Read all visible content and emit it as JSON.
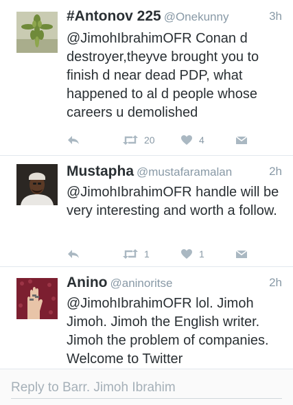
{
  "tweets": [
    {
      "name": "#Antonov 225",
      "handle": "@Onekunny",
      "time": "3h",
      "text": "@JimohIbrahimOFR Conan d destroyer,theyve brought you to finish d near dead PDP, what happened to al d people whose careers u demolished",
      "retweets": "20",
      "likes": "4",
      "avatar_icon": "leaf-cross-icon"
    },
    {
      "name": "Mustapha",
      "handle": "@mustafaramalan",
      "time": "2h",
      "text": "@JimohIbrahimOFR handle will be very interesting and worth a follow.",
      "retweets": "1",
      "likes": "1",
      "avatar_icon": "person-photo-icon"
    },
    {
      "name": "Anino",
      "handle": "@aninoritse",
      "time": "2h",
      "text": "@JimohIbrahimOFR lol. Jimoh Jimoh. Jimoh the English writer. Jimoh the problem of companies. Welcome to Twitter",
      "retweets": "",
      "likes": "",
      "avatar_icon": "hand-rings-icon"
    }
  ],
  "reply": {
    "placeholder": "Reply to Barr. Jimoh Ibrahim"
  },
  "colors": {
    "text": "#292f33",
    "meta": "#8899a6",
    "divider": "#e1e8ed"
  }
}
